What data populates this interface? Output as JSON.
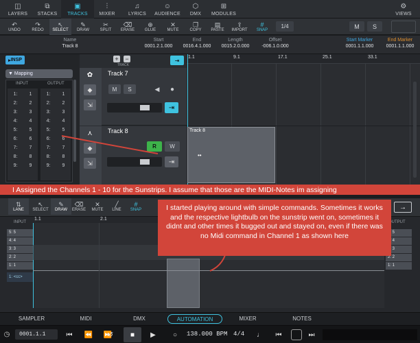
{
  "nav": {
    "tabs": [
      {
        "label": "LAYERS",
        "icon": "layers-icon"
      },
      {
        "label": "STACKS",
        "icon": "stacks-icon"
      },
      {
        "label": "TRACKS",
        "icon": "tracks-icon"
      },
      {
        "label": "MIXER",
        "icon": "mixer-icon"
      },
      {
        "label": "LYRICS",
        "icon": "lyrics-icon"
      },
      {
        "label": "AUDIENCE",
        "icon": "audience-icon"
      },
      {
        "label": "DMX",
        "icon": "dmx-icon"
      },
      {
        "label": "MODULES",
        "icon": "modules-icon"
      },
      {
        "label": "VIEWS",
        "icon": "views-icon"
      }
    ],
    "active": "TRACKS",
    "accent": "#3fc3e0"
  },
  "toolbar": {
    "tools": [
      {
        "label": "UNDO",
        "glyph": "↶"
      },
      {
        "label": "REDO",
        "glyph": "↷"
      },
      {
        "label": "SELECT",
        "glyph": "↖"
      },
      {
        "label": "DRAW",
        "glyph": "✎"
      },
      {
        "label": "SPLIT",
        "glyph": "✂"
      },
      {
        "label": "ERASE",
        "glyph": "⌫"
      },
      {
        "label": "GLUE",
        "glyph": "⊕"
      },
      {
        "label": "MUTE",
        "glyph": "✕"
      },
      {
        "label": "COPY",
        "glyph": "❐"
      },
      {
        "label": "PASTE",
        "glyph": "▤"
      },
      {
        "label": "IMPORT",
        "glyph": "⇪"
      },
      {
        "label": "SNAP",
        "glyph": "#"
      }
    ],
    "quantize": "1/4",
    "m_label": "M",
    "s_label": "S"
  },
  "info": {
    "name_label": "Name",
    "name_value": "Track 8",
    "start_label": "Start",
    "start_value": "0001.2.1.000",
    "end_label": "End",
    "end_value": "0016.4.1.000",
    "length_label": "Length",
    "length_value": "0015.2.0.000",
    "offset_label": "Offset",
    "offset_value": "-006.1.0.000",
    "start_marker_label": "Start Marker",
    "start_marker_value": "0001.1.1.000",
    "end_marker_label": "End Marker",
    "end_marker_value": "0001.1.1.000",
    "start_marker_color": "#3fa7e0",
    "end_marker_color": "#e0902f"
  },
  "inspector": {
    "insp_label": "INSP",
    "track_label": "TRACK",
    "mapping_label": "Mapping",
    "input_header": "INPUT",
    "output_header": "OUTPUT",
    "rows": [
      {
        "in": "1:",
        "out": "1",
        "in2": "1:",
        "out2": "1"
      },
      {
        "in": "2:",
        "out": "2",
        "in2": "2:",
        "out2": "2"
      },
      {
        "in": "3:",
        "out": "3",
        "in2": "3:",
        "out2": "3"
      },
      {
        "in": "4:",
        "out": "4",
        "in2": "4:",
        "out2": "4"
      },
      {
        "in": "5:",
        "out": "5",
        "in2": "5:",
        "out2": "5"
      },
      {
        "in": "6:",
        "out": "6",
        "in2": "6:",
        "out2": "6"
      },
      {
        "in": "7:",
        "out": "7",
        "in2": "7:",
        "out2": "7"
      },
      {
        "in": "8:",
        "out": "8",
        "in2": "8:",
        "out2": "8"
      },
      {
        "in": "9:",
        "out": "9",
        "in2": "9:",
        "out2": "9"
      }
    ]
  },
  "tracks": [
    {
      "name": "Track 7",
      "m": "M",
      "s": "S"
    },
    {
      "name": "Track 8",
      "r": "R",
      "w": "W"
    }
  ],
  "ruler": [
    "1.1",
    "9.1",
    "17.1",
    "25.1",
    "33.1"
  ],
  "clip": {
    "name": "Track 8",
    "dots": "••"
  },
  "annotations": {
    "banner": "I Assigned the Channels 1 - 10 for the Sunstrips. I assume that those are the MIDI-Notes im assigning",
    "callout": "I started playing around with simple commands. Sometimes it works and the respective lightbulb on the sunstrip went on, sometimes it didnt and other times it bugged out and stayed on, even if there was no Midi command in Channel 1 as shown here"
  },
  "editor": {
    "tools": [
      {
        "label": "LANE",
        "glyph": "⇅"
      },
      {
        "label": "SELECT",
        "glyph": "↖"
      },
      {
        "label": "DRAW",
        "glyph": "✎"
      },
      {
        "label": "ERASE",
        "glyph": "⌫"
      },
      {
        "label": "MUTE",
        "glyph": "✕"
      },
      {
        "label": "LINE",
        "glyph": "╱"
      },
      {
        "label": "SNAP",
        "glyph": "#"
      }
    ],
    "input_label": "INPUT",
    "output_label": "OUTPUT",
    "ruler": [
      "1.1",
      "2.1"
    ],
    "rows_left": [
      "5: 5",
      "4: 4",
      "3: 3",
      "2: 2",
      "1: 1"
    ],
    "rows_right": [
      "5: 5",
      "4: 4",
      "3: 3",
      "2: 2",
      "1: 1"
    ],
    "cc_label": "1: <cc>"
  },
  "bottom_tabs": [
    "SAMPLER",
    "MIDI",
    "DMX",
    "AUTOMATION",
    "MIXER",
    "NOTES"
  ],
  "bottom_active": "AUTOMATION",
  "transport": {
    "position": "0001.1.1",
    "bpm": "138.000 BPM",
    "signature": "4/4"
  }
}
